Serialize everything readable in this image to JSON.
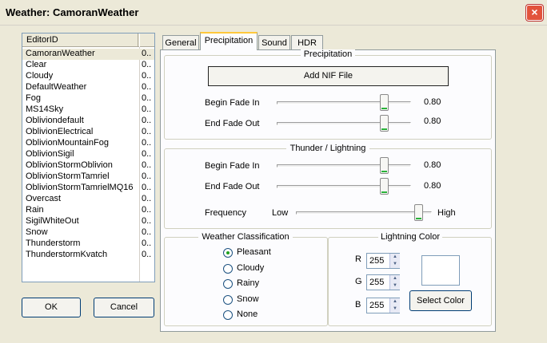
{
  "window": {
    "title": "Weather: CamoranWeather",
    "close_glyph": "×"
  },
  "list": {
    "header_editorid": "EditorID",
    "rows": [
      {
        "id": "CamoranWeather",
        "v": "0.."
      },
      {
        "id": "Clear",
        "v": "0.."
      },
      {
        "id": "Cloudy",
        "v": "0.."
      },
      {
        "id": "DefaultWeather",
        "v": "0.."
      },
      {
        "id": "Fog",
        "v": "0.."
      },
      {
        "id": "MS14Sky",
        "v": "0.."
      },
      {
        "id": "Obliviondefault",
        "v": "0.."
      },
      {
        "id": "OblivionElectrical",
        "v": "0.."
      },
      {
        "id": "OblivionMountainFog",
        "v": "0.."
      },
      {
        "id": "OblivionSigil",
        "v": "0.."
      },
      {
        "id": "OblivionStormOblivion",
        "v": "0.."
      },
      {
        "id": "OblivionStormTamriel",
        "v": "0.."
      },
      {
        "id": "OblivionStormTamrielMQ16",
        "v": "0.."
      },
      {
        "id": "Overcast",
        "v": "0.."
      },
      {
        "id": "Rain",
        "v": "0.."
      },
      {
        "id": "SigilWhiteOut",
        "v": "0.."
      },
      {
        "id": "Snow",
        "v": "0.."
      },
      {
        "id": "Thunderstorm",
        "v": "0.."
      },
      {
        "id": "ThunderstormKvatch",
        "v": "0.."
      }
    ]
  },
  "buttons": {
    "ok": "OK",
    "cancel": "Cancel"
  },
  "tabs": {
    "general": "General",
    "precipitation": "Precipitation",
    "sound": "Sound",
    "hdr": "HDR"
  },
  "precipitation": {
    "title": "Precipitation",
    "add_nif": "Add NIF File",
    "begin_label": "Begin Fade In",
    "begin_value": "0.80",
    "begin_level": 0.8,
    "end_label": "End Fade Out",
    "end_value": "0.80",
    "end_level": 0.8
  },
  "thunder": {
    "title": "Thunder / Lightning",
    "begin_label": "Begin Fade In",
    "begin_value": "0.80",
    "begin_level": 0.8,
    "end_label": "End Fade Out",
    "end_value": "0.80",
    "end_level": 0.8,
    "freq_label": "Frequency",
    "freq_low": "Low",
    "freq_high": "High",
    "freq_level": 0.9
  },
  "classification": {
    "title": "Weather Classification",
    "options": [
      "Pleasant",
      "Cloudy",
      "Rainy",
      "Snow",
      "None"
    ],
    "selected": "Pleasant"
  },
  "lightning": {
    "title": "Lightning Color",
    "r_label": "R",
    "r": "255",
    "g_label": "G",
    "g": "255",
    "b_label": "B",
    "b": "255",
    "select_color": "Select Color",
    "swatch_color": "#ffffff"
  }
}
